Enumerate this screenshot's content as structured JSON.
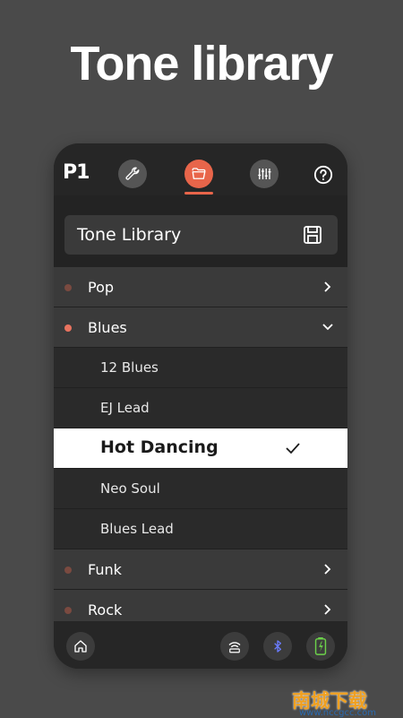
{
  "hero": {
    "title": "Tone library"
  },
  "app": {
    "logo": "P1",
    "nav": [
      {
        "icon": "wrench-icon"
      },
      {
        "icon": "folder-icon",
        "active": true
      },
      {
        "icon": "mixer-icon"
      },
      {
        "icon": "help-icon"
      }
    ],
    "accent": "#e8654a"
  },
  "library": {
    "title": "Tone Library",
    "save_icon": "save-icon",
    "rows": [
      {
        "type": "category",
        "label": "Pop",
        "dot_color": "#7a4a40",
        "expanded": false
      },
      {
        "type": "category",
        "label": "Blues",
        "dot_color": "#e8735f",
        "expanded": true
      },
      {
        "type": "tone",
        "label": "12 Blues"
      },
      {
        "type": "tone",
        "label": "EJ Lead"
      },
      {
        "type": "tone",
        "label": "Hot Dancing",
        "selected": true
      },
      {
        "type": "tone",
        "label": "Neo Soul"
      },
      {
        "type": "tone",
        "label": "Blues Lead"
      },
      {
        "type": "category",
        "label": "Funk",
        "dot_color": "#7a4a40",
        "expanded": false
      },
      {
        "type": "category",
        "label": "Rock",
        "dot_color": "#7a4a40",
        "expanded": false
      }
    ]
  },
  "bottom": {
    "icons": [
      "home-icon",
      "wireless-icon",
      "bluetooth-icon",
      "battery-icon"
    ]
  },
  "watermark": {
    "text": "南城下载",
    "url": "www.nccgcc.com"
  }
}
